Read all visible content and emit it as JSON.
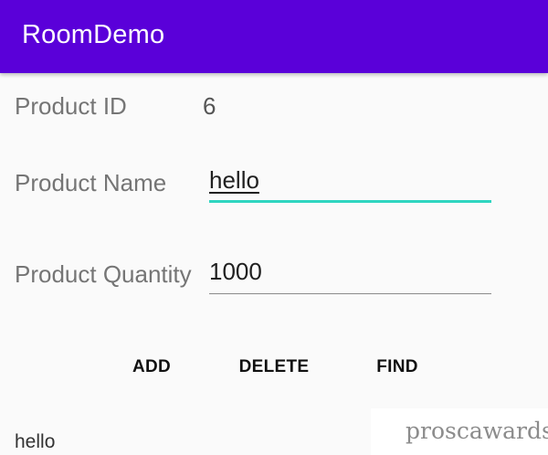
{
  "app_bar": {
    "title": "RoomDemo",
    "color": "#5a00d9"
  },
  "form": {
    "product_id_label": "Product ID",
    "product_id_value": "6",
    "product_name_label": "Product Name",
    "product_name_value": "hello",
    "product_quantity_label": "Product Quantity",
    "product_quantity_value": "1000"
  },
  "buttons": {
    "add": "ADD",
    "delete": "DELETE",
    "find": "FIND"
  },
  "result": {
    "text": "hello"
  },
  "watermark": {
    "text": "proscawards"
  },
  "colors": {
    "accent": "#2fd5c0"
  }
}
